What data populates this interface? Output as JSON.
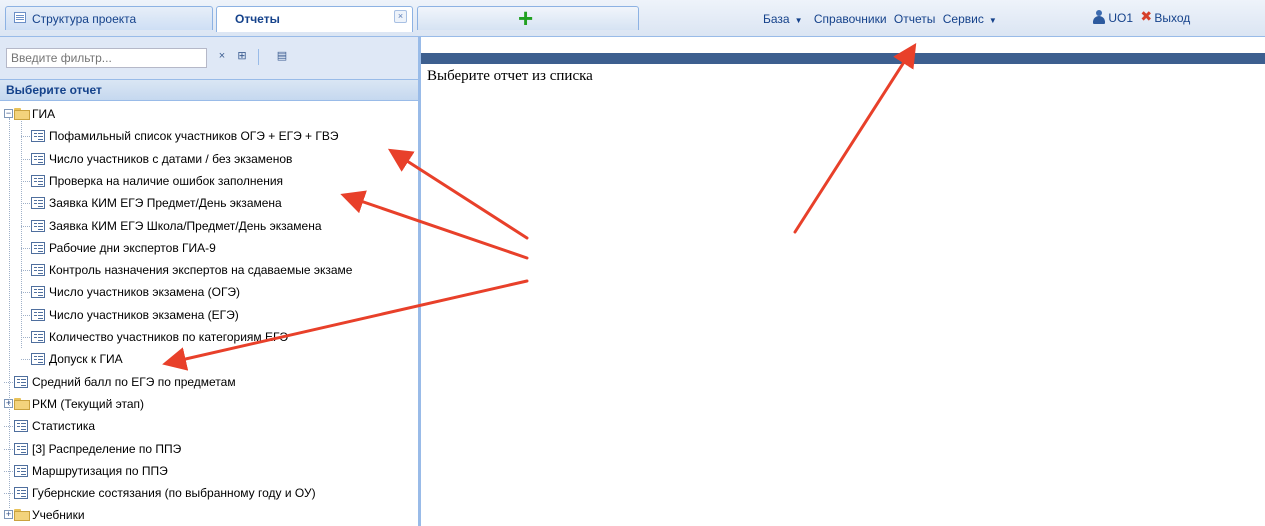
{
  "tabs": [
    {
      "label": "Структура проекта"
    },
    {
      "label": "Отчеты",
      "close": "×"
    },
    {
      "label": "",
      "icon": "plus-icon"
    }
  ],
  "menu": {
    "items": [
      "База",
      "Справочники",
      "Отчеты",
      "Сервис"
    ],
    "user": "UO1",
    "exit": "Выход"
  },
  "filter": {
    "placeholder": "Введите фильтр...",
    "clear": "×"
  },
  "panel_title": "Выберите отчет",
  "tree": [
    {
      "label": "ГИА",
      "type": "folder",
      "expanded": true,
      "level": 0
    },
    {
      "label": "Пофамильный список участников ОГЭ + ЕГЭ + ГВЭ",
      "type": "report",
      "level": 1
    },
    {
      "label": "Число участников с датами / без экзаменов",
      "type": "report",
      "level": 1
    },
    {
      "label": "Проверка на наличие ошибок заполнения",
      "type": "report",
      "level": 1
    },
    {
      "label": "Заявка КИМ ЕГЭ Предмет/День экзамена",
      "type": "report",
      "level": 1
    },
    {
      "label": "Заявка КИМ ЕГЭ Школа/Предмет/День экзамена",
      "type": "report",
      "level": 1
    },
    {
      "label": "Рабочие дни экспертов ГИА-9",
      "type": "report",
      "level": 1
    },
    {
      "label": "Контроль назначения экспертов на сдаваемые экзаме",
      "type": "report",
      "level": 1
    },
    {
      "label": "Число участников экзамена (ОГЭ)",
      "type": "report",
      "level": 1
    },
    {
      "label": "Число участников экзамена (ЕГЭ)",
      "type": "report",
      "level": 1
    },
    {
      "label": "Количество участников по категориям ЕГЭ",
      "type": "report",
      "level": 1
    },
    {
      "label": "Допуск к ГИА",
      "type": "report",
      "level": 1
    },
    {
      "label": "Средний балл по ЕГЭ по предметам",
      "type": "report",
      "level": 0
    },
    {
      "label": "РКМ (Текущий этап)",
      "type": "folder",
      "expanded": false,
      "level": 0
    },
    {
      "label": "Статистика",
      "type": "report",
      "level": 0
    },
    {
      "label": "[3] Распределение по ППЭ",
      "type": "report",
      "level": 0
    },
    {
      "label": "Маршрутизация по ППЭ",
      "type": "report",
      "level": 0
    },
    {
      "label": "Губернские состязания (по выбранному году и ОУ)",
      "type": "report",
      "level": 0
    },
    {
      "label": "Учебники",
      "type": "folder",
      "expanded": false,
      "level": 0
    }
  ],
  "main_text": "Выберите отчет из списка",
  "colors": {
    "accent": "#15428b",
    "annotation_arrow": "#e8402a",
    "header_bar": "#3d5f8f"
  }
}
